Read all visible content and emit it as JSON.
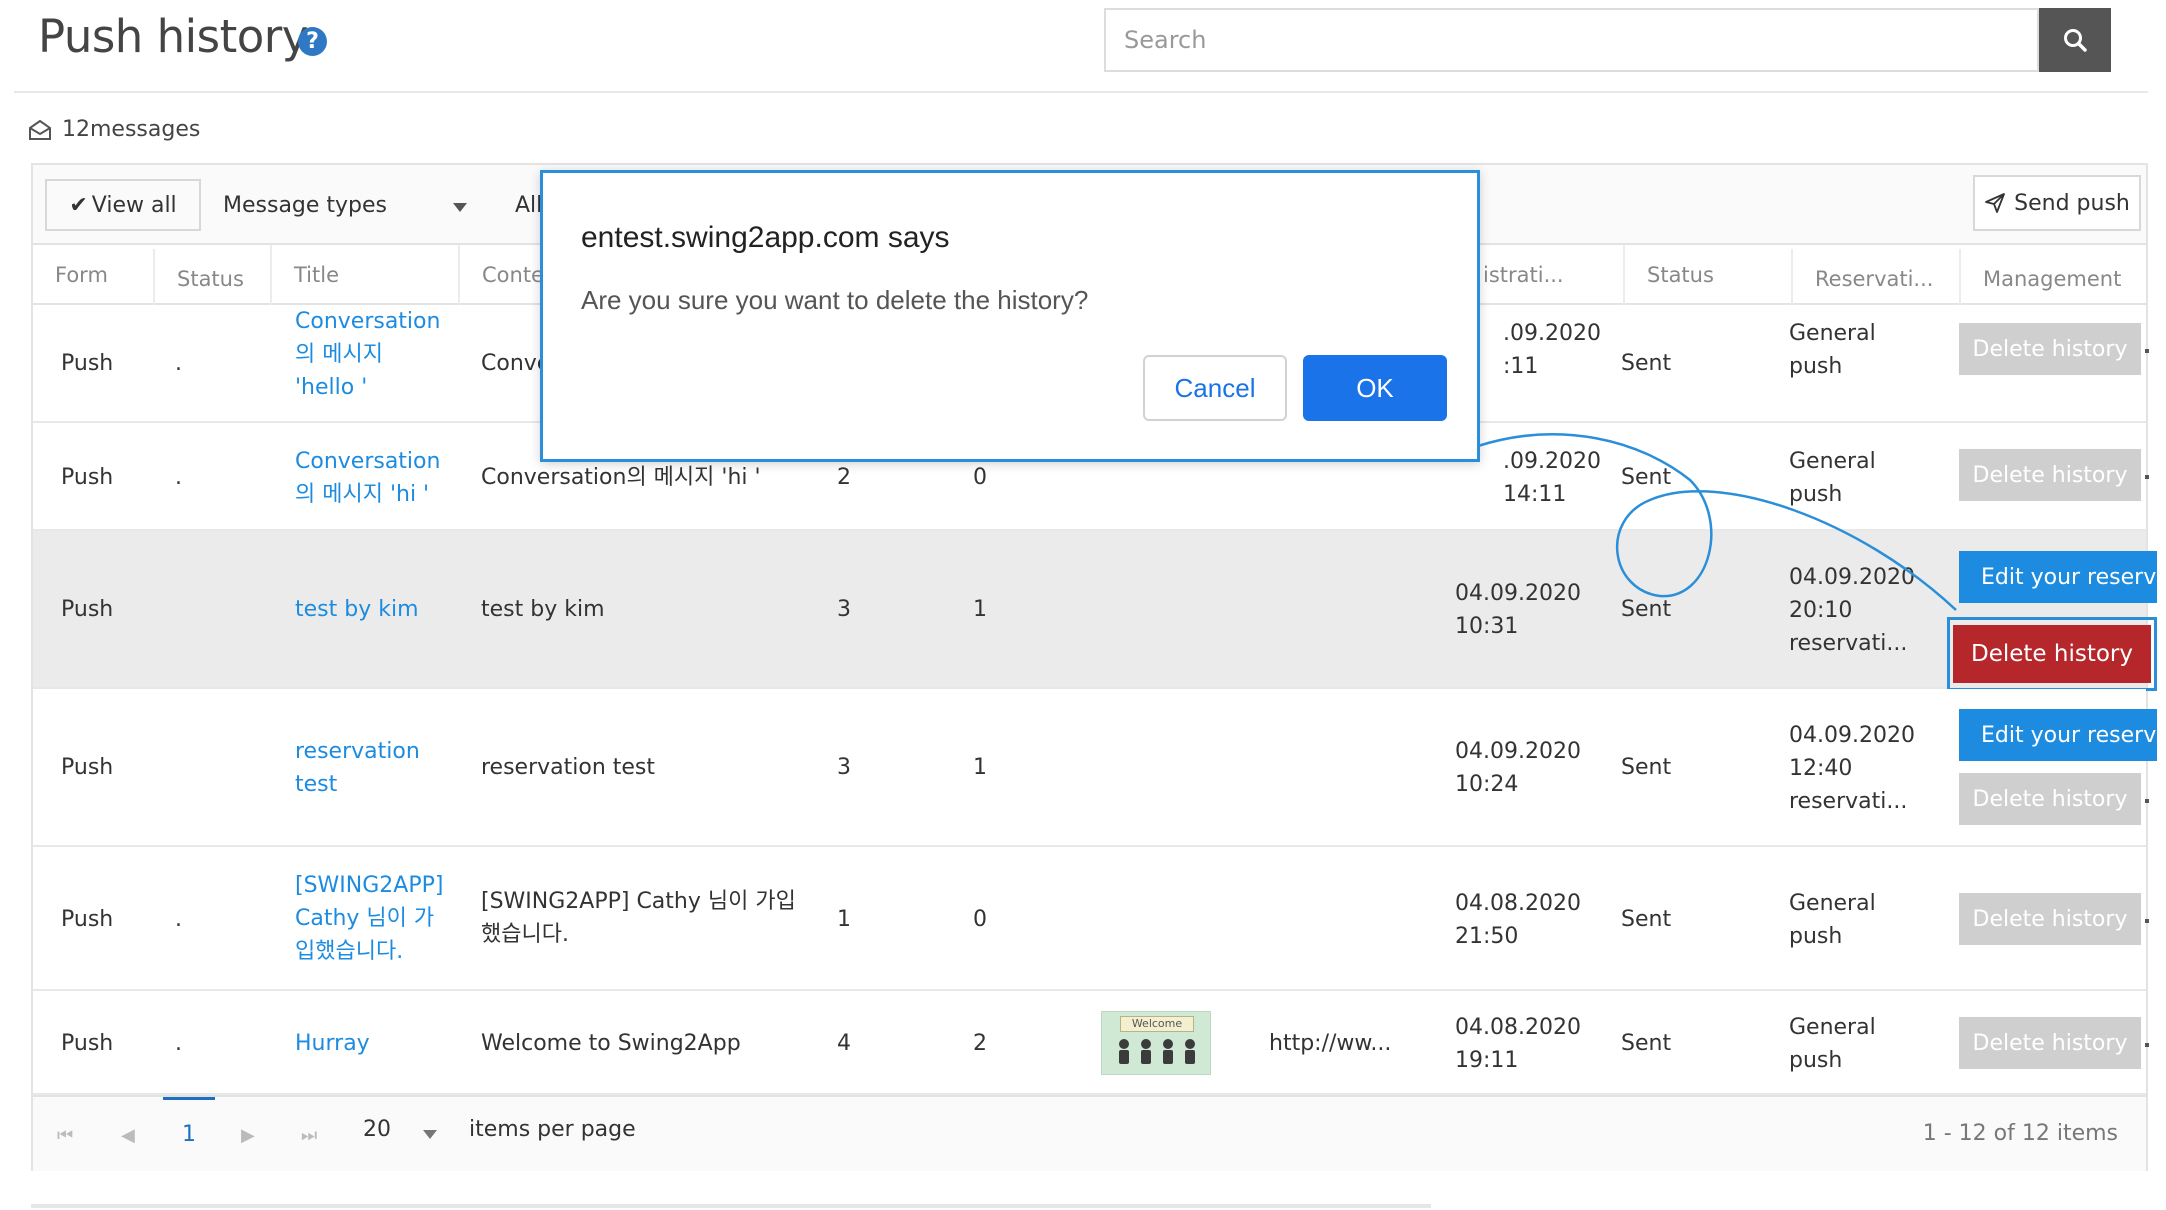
{
  "header": {
    "title": "Push history",
    "help_icon": "?",
    "search_placeholder": "Search"
  },
  "message_count": "12messages",
  "toolbar": {
    "view_all": "View all",
    "message_types": "Message types",
    "filter_all": "All",
    "send_push": "Send push"
  },
  "columns": [
    "Form",
    "Status",
    "Title",
    "Conte",
    "istrati...",
    "Status",
    "Reservati...",
    "Management"
  ],
  "rows": [
    {
      "form": "Push",
      "status": ".",
      "title": [
        "Conversation",
        "의 메시지",
        "'hello '"
      ],
      "content": "Conver",
      "registration": [
        ".09.2020",
        ":11"
      ],
      "sent": "Sent",
      "reservation": [
        "General",
        "push"
      ],
      "delete": "Delete history"
    },
    {
      "form": "Push",
      "status": ".",
      "title": [
        "Conversation",
        "의 메시지 'hi '"
      ],
      "content": "Conversation의 메시지 'hi '",
      "c1": "2",
      "c2": "0",
      "registration": [
        ".09.2020",
        "14:11"
      ],
      "sent": "Sent",
      "reservation": [
        "General",
        "push"
      ],
      "delete": "Delete history"
    },
    {
      "form": "Push",
      "status": "",
      "title": [
        "test by kim"
      ],
      "content": "test by kim",
      "c1": "3",
      "c2": "1",
      "registration": [
        "04.09.2020",
        "10:31"
      ],
      "sent": "Sent",
      "reservation": [
        "04.09.2020",
        "20:10",
        "reservati..."
      ],
      "edit": "Edit your reserva",
      "delete": "Delete history"
    },
    {
      "form": "Push",
      "status": "",
      "title": [
        "reservation",
        "test"
      ],
      "content": "reservation test",
      "c1": "3",
      "c2": "1",
      "registration": [
        "04.09.2020",
        "10:24"
      ],
      "sent": "Sent",
      "reservation": [
        "04.09.2020",
        "12:40",
        "reservati..."
      ],
      "edit": "Edit your reserva",
      "delete": "Delete history"
    },
    {
      "form": "Push",
      "status": ".",
      "title": [
        "[SWING2APP]",
        "Cathy 님이 가",
        "입했습니다."
      ],
      "content": [
        "[SWING2APP] Cathy 님이 가입",
        "했습니다."
      ],
      "c1": "1",
      "c2": "0",
      "registration": [
        "04.08.2020",
        "21:50"
      ],
      "sent": "Sent",
      "reservation": [
        "General",
        "push"
      ],
      "delete": "Delete history"
    },
    {
      "form": "Push",
      "status": ".",
      "title": [
        "Hurray"
      ],
      "content": "Welcome to Swing2App",
      "c1": "4",
      "c2": "2",
      "thumb_label": "Welcome",
      "link": "http://ww...",
      "registration": [
        "04.08.2020",
        "19:11"
      ],
      "sent": "Sent",
      "reservation": [
        "General",
        "push"
      ],
      "delete": "Delete history"
    }
  ],
  "pager": {
    "current_page": "1",
    "page_size": "20",
    "items_per_page": "items per page",
    "info": "1 - 12 of 12 items"
  },
  "dialog": {
    "title": "entest.swing2app.com says",
    "message": "Are you sure you want to delete the history?",
    "cancel": "Cancel",
    "ok": "OK"
  },
  "colors": {
    "accent_blue": "#1d8ce0",
    "delete_red": "#b5272b",
    "disabled_gray": "#cfcfcf",
    "dialog_blue": "#1a73e8"
  }
}
